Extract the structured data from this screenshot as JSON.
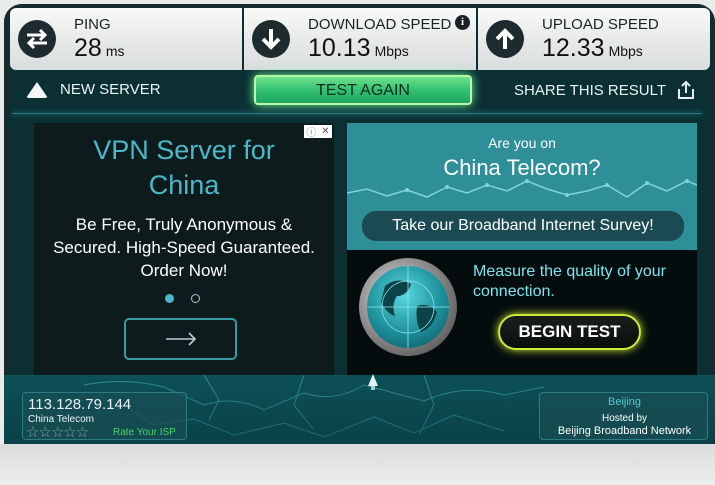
{
  "stats": {
    "ping": {
      "label": "PING",
      "value": "28",
      "unit": "ms"
    },
    "download": {
      "label": "DOWNLOAD SPEED",
      "value": "10.13",
      "unit": "Mbps"
    },
    "upload": {
      "label": "UPLOAD SPEED",
      "value": "12.33",
      "unit": "Mbps"
    }
  },
  "actions": {
    "new_server": "NEW SERVER",
    "test_again": "TEST AGAIN",
    "share": "SHARE THIS RESULT"
  },
  "ad_left": {
    "headline": "VPN Server for China",
    "body": "Be Free, Truly Anonymous & Secured. High-Speed Guaranteed. Order Now!",
    "active_slide": 1,
    "slide_count": 2
  },
  "ad_right": {
    "question_small": "Are you on",
    "question_large": "China Telecom?",
    "survey_button": "Take our Broadband Internet Survey!",
    "measure_text": "Measure the quality of your connection.",
    "begin_button": "BEGIN TEST"
  },
  "client": {
    "ip": "113.128.79.144",
    "isp": "China Telecom",
    "stars": "☆☆☆☆☆",
    "rate_label": "Rate Your ISP"
  },
  "server": {
    "city": "Beijing",
    "hosted_by": "Hosted by",
    "network": "Beijing Broadband Network"
  },
  "colors": {
    "frame": "#0b2f33",
    "accent_teal": "#4ab9c7",
    "green_button": "#2fbf73",
    "lime_glow": "#c9ef3a"
  }
}
